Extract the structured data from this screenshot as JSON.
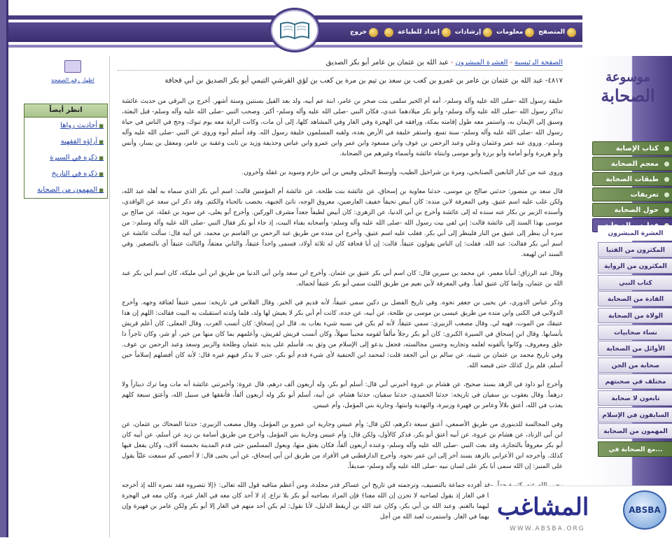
{
  "toolbar": {
    "items": [
      {
        "label": "المتصفح",
        "icon": "browser-icon"
      },
      {
        "label": "معلومات",
        "icon": "info-icon"
      },
      {
        "label": "إرشادات",
        "icon": "guide-icon"
      },
      {
        "label": "إعداد للطباعة",
        "icon": "print-icon"
      },
      {
        "label": "",
        "icon": "blank-icon"
      },
      {
        "label": "خروج",
        "icon": "exit-icon"
      }
    ]
  },
  "site": {
    "title_line1": "موسوعة",
    "title_line2": "الصحابة"
  },
  "nav": {
    "items": [
      "كتاب الإصابة",
      "معجم الصحابة",
      "طبقات الصحابة",
      "تعريفات",
      "حول الصحابة",
      "فهارس الصحابة"
    ],
    "subitems": [
      "العشرة المبشرون",
      "المكثرون من الفتيا",
      "المكثرون من الرواية",
      "كتاب النبي",
      "القادة من الصحابة",
      "الولاة من الصحابة",
      "نساء صحابيات",
      "الأوائل من الصحابة",
      "صحابة من الجن",
      "مختلف في صحبتهم",
      "تابعون لا صحابة",
      "السابقون في الإسلام",
      "المهمون من الصحابة",
      "مع الصحابة في..."
    ]
  },
  "left": {
    "print_label": "اظهار رقم الصفحة",
    "see_also_title": "انظر أيضاً",
    "see_also": [
      "أحاديث رواها",
      "آراؤه الفقهية",
      "ذكره في السيرة",
      "ذكره في التاريخ",
      "المهمون من الصحابة"
    ]
  },
  "breadcrumb": {
    "home": "الصفحة الرئيسية",
    "section": "العشرة المبشرون",
    "current": "عبد الله بن عثمان بن عامر أبو بكر الصديق"
  },
  "entry": {
    "title": "٤٨١٧- عبد الله بن عثمان بن عامر بن عمرو بن كعب بن سعد بن تيم بن مرة بن كعب بن لؤي القرشي التيمي أبو بكر الصديق بن أبي قحافة"
  },
  "body": {
    "p1": "خليفة رسول الله -صلى الله عليه وآله وسلم-. أمه أم الخير سلمى بنت صخر بن عامر، ابنة عم أبيه، ولد بعد الفيل بسنتين وستة أشهر. أخرج بن البرقي من حديث عائشة تذاكر رسول الله -صلى الله عليه وآله وسلم- وأبو بكر ميلادهما عندي، فكان النبي -صلى الله عليه وآله وسلم- أكبر. وصحب النبي -صلى الله عليه وآله وسلم- قبل البعثة، وسبق إلى الإيمان به، واستمر معه طول إقامته بمكة، ورافقه في الهجرة وفي الغار وفي المشاهد كلها، إلى أن مات، وكانت الراية معه يوم تبوك، وحج في الناس في حياة رسول الله -صلى الله عليه وآله وسلم- سنة تسع، واستقر خليفة في الأرض بعده، ولقبه المسلمون خليفة رسول الله. وقد أسلم أبوه وروى عن النبي -صلى الله عليه وآله وسلم-. وروى عنه عمر وعثمان وعلي وعبد الرحمن بن عوف وابن مسعود وابن عمر وابن عمرو وابن عباس وحذيفة وزيد بن ثابت وعقبة بن عامر، ومعقل بن يسار، وأنس وأبو هريرة وأبو أمامة وأبو برزة وأبو موسى وابنتاه عائشة وأسماء وغيرهم من الصحابة.",
    "p2": "وروى عنه من كبار التابعين الصنابحي، ومرة بن شراحيل الطيب، وأوسط البجلي وقيس بن أبي حازم وسويد بن غفلة وآخرون.",
    "p3": "قال سعد بن منصور: حدثني صالح بن موسى، حدثنا معاوية بن إسحاق، عن عائشة بنت طلحة، عن عائشة أم المؤمنين قالت: اسم أبي بكر الذي سماه به أهله عبد الله، ولكن غلب عليه اسم عتيق. وفي المعرفة لابن منده: كان أبيض نحيفاً خفيف العارضين، معروق الوجه، ناتئ الجبهة، يخضب بالحناء والكتم. وقد ذكر ابن سعد عن الواقدي، وأسنده الزبير بن بكار عنه سنده له إلى عائشة وأخرج بن أبي الدنيا، عن الزهري: كان أبيض لطيفاً جعداً مشرف الوركين. وأخرج أبو يعلى، عن سويد بن غفلة، عن صالح بن موسى بهذا السند إلى عائشة قالت: إني لفي بيت رسول الله -صلى الله عليه وآله وسلم- وأصحابه بفناء البيت، إذ جاء أبو بكر فقال النبي -صلى الله عليه وآله وسلم-: من سره أن ينظر إلى عتيق من النار فلينظر إلى أبي بكر. فغلب عليه اسم عتيق. وأخرج ابن منده من طريق عبد الرحمن بن القاسم بن محمد، عن أبيه قال: سألت عائشة عن اسم أبي بكر فقالت: عبد الله. فقلت: إن الناس يقولون عتيقاً. قالت: إن أبا قحافة كان له ثلاثة أولاد، فسمى واحداً عتيقاً، والثاني معتقاً، والثالث عتيقاً أي بالتصغير. وفي السند ابن لهيعة.",
    "p4": "وقال عبد الرزاق: أنبأنا معمر، عن محمد بن سيرين قال: كان اسم أبي بكر عتيق بن عثمان. وأخرج ابن سعد وابن أبي الدنيا من طريق ابن أبي مليكة، كان اسم أبي بكر عبد الله بن عثمان، وإنما كان عتيق لقباً. وفي المعرفة لأبي نعيم من طريق الليث سمي أبو بكر عتيقاً لجماله.",
    "p5": "وذكر عباس الدوري، عن يحيى بن جعفر نحوه. وفي تاريخ الفضل بن دكين سمي عتيقاً، لأنه قديم في الخير. وقال الفلاس في تاريخه: سمي عتيقاً لعتاقة وجهه. وأخرج الدولابي في الكنى وابن منده من طريق عيسى بن موسى بن طلحة، عن أبيه، عن جده، كانت أم أبي بكر لا يعيش لها ولد، فلما ولدته استقبلت به البيت فقالت: اللهم إن هذا عتيقك من الموت، فهبه لي. وقال مصعب الزبيري: سمي عتيقاً، لأنه لم يكن في نسبه شيء يعاب به. قال ابن إسحاق: كان أنسب العرب. وقال المعلى: كان أعلم قريش بأنسابها. وقال ابن إسحاق في السيرة الكبرى: كان أبو بكر رجلاً مألفاً لقومه محبباً سهلاً، وكان أنسب قريش لقريش، وأعلمهم بما كان منها من خير، أو شر، وكان تاجراً ذا خلق ومعروف، وكانوا يألفونه لعلمه وتجاربه وحسن مجالسته، فجعل يدعو إلى الإسلام من وثق به، فأسلم على يديه عثمان وطلحة والزبير وسعد وعبد الرحمن بن عوف. وفي تاريخ محمد بن عثمان بن شيبة، عن سالم بن أبي الجعد قلت: لمحمد ابن الحنفية لأي شيء قدم أبو بكر، حتى لا يذكر فيهم غيره قال: لأنه كان أفضلهم إسلاماً حين أسلم، فلم يزل كذلك حتى قبضه الله.",
    "p6": "وأخرج أبو داود في الزهد بسند صحيح، عن هشام بن عروة أخبرني أبي قال: أسلم أبو بكر، وله أربعون ألف درهم، قال عروة: وأخبرتني عائشة أنه مات وما ترك ديناراً ولا درهماً. وقال يعقوب بن سفيان في تاريخه: حدثنا الحميدي، حدثنا سفيان، حدثنا هشام، عن أبيه، أسلم أبو بكر وله أربعون ألفاً، فأنفقها في سبيل الله، وأعتق سبعة كلهم يعذب في الله، أعتق بلالاً وعامر بن فهيرة وزنيرة، والنهدية وابنتها، وجارية بني المؤمل، وأم عبيس.",
    "p7": "وفي المجالسة للدينوري من طريق الأصمعي، أعتق سبعة ذكرهم، لكن قال: وأم عبيس وجارية ابن عمرو بن المؤمل، وقال مصعب الزبيري: حدثنا الضحاك بن عثمان، عن ابن أبي الزناد، عن هشام بن عروة، عن أبيه أعتق أبو بكر، فذكر كالأول، ولكن قال: وأم عبيس وجارية بني المؤمل، وأخرج من طريق أسامة بن زيد عن أسلم، عن أبيه كان أبو بكر معروفاً بالتجارة، وقد بعث النبي -صلى الله عليه وآله وسلم- وعنده أربعون ألفاً، فكان يعتق منها، ويعول المسلمين حتى قدم المدينة بخمسة آلاف، وكان يفعل فيها كذلك. وأخرجه ابن الأعرابي بالزهد بسند آخر إلى ابن عمر نحوه. وأخرج الدارقطني في الأفراد من طريق ابن أبي إسحاق، عن أبي يحيى قال: لا أحصي كم سمعت عليّاً يقول على المنبر: إن الله سمى أبا بكر على لسان نبيه -صلى الله عليه وآله وسلم- صديقاً.",
    "p8": "رضي الله عنه. كثيرة جداً، وقد أفرده جماعة بالتصنيف، وترجمته في تاريخ ابن عساكر قدر مجلدة، ومن أعظم مناقبه قول الله تعالى: ﴿إلا تنصروه فقد نصره الله إذ أخرجه الذين كفروا ثاني اثنين إذ هما في الغار إذ يقول لصاحبه لا تحزن إن الله معنا﴾ فإن المراد بصاحبه أبو بكر بلا نزاع. إذ لا أحد كان معه في الغار غيره. وكان معه في الهجرة عامر بن فهيرة وكان يروح عليهما بالغنم. وعبد الله بن أبي بكر، وكان عبد الله بن أريقط الدليل، لأنا نقول: لم يكن أحد منهم في الغار إلا أبو بكر ولكن عامر بن فهيرة وإن كان يتردد إليهما فإنما كان يأتيهما في الغار. واستمرت لعبد الله من أجل"
  },
  "banner": {
    "text": "المشاغب",
    "badge": "ABSBA",
    "url": "WWW.ABSBA.ORG"
  }
}
